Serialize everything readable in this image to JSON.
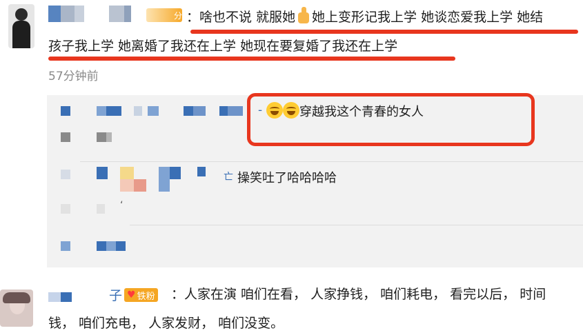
{
  "comment1": {
    "badge_label": "分",
    "text_line1": "：啥也不说 就服她",
    "text_line1b": "她上变形记我上学 她谈恋爱我上学 她结",
    "text_line2": "孩子我上学 她离婚了我还在上学  她现在要复婚了我还在上学",
    "time": "57分钟前",
    "thumb_icon": "thumbs-up-icon"
  },
  "reply1": {
    "separator": "-",
    "text": "穿越我这个青春的女人",
    "emoji_icons": [
      "laughing-crying-icon",
      "laughing-crying-icon"
    ]
  },
  "reply2": {
    "text": "操笑吐了哈哈哈哈",
    "prefix": "亡"
  },
  "reply3": {
    "text": "‘"
  },
  "comment2": {
    "user_suffix": "子",
    "badge_label": "铁粉",
    "text_line1": "：人家在演 咱们在看， 人家挣钱， 咱们耗电， 看完以后， 时间",
    "text_line2": "钱， 咱们充电， 人家发财， 咱们没变。"
  },
  "colors": {
    "accent_red": "#e8361e",
    "badge_orange": "#f5a623",
    "reply_bg": "#f2f2f2",
    "blur_blue": "#3a6fb5"
  }
}
